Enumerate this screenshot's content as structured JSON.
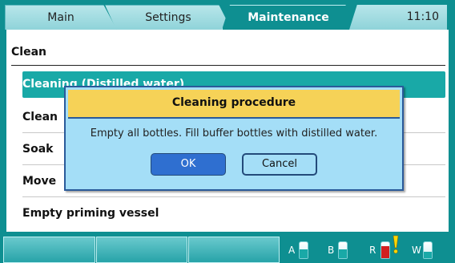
{
  "tabs": {
    "main": "Main",
    "settings": "Settings",
    "maintenance": "Maintenance"
  },
  "clock": "11:10",
  "section": {
    "title": "Clean"
  },
  "menu": {
    "items": [
      {
        "label": "Cleaning (Distilled water)",
        "selected": true
      },
      {
        "label": "Clean"
      },
      {
        "label": "Soak"
      },
      {
        "label": "Move"
      },
      {
        "label": "Empty priming vessel"
      }
    ]
  },
  "dialog": {
    "title": "Cleaning procedure",
    "message": "Empty all bottles. Fill buffer bottles with distilled water.",
    "ok_label": "OK",
    "cancel_label": "Cancel"
  },
  "statusbar": {
    "bottles": [
      {
        "label": "A",
        "state": "normal"
      },
      {
        "label": "B",
        "state": "normal"
      },
      {
        "label": "R",
        "state": "warning"
      },
      {
        "label": "W",
        "state": "normal"
      }
    ]
  },
  "colors": {
    "background": "#0e8f91",
    "selected_row": "#19a9a7",
    "dialog_title": "#f6d257",
    "dialog_body": "#a4def7",
    "ok_button": "#2f6fd0",
    "warning": "#ffd800",
    "bottle_red": "#d21f1f"
  }
}
